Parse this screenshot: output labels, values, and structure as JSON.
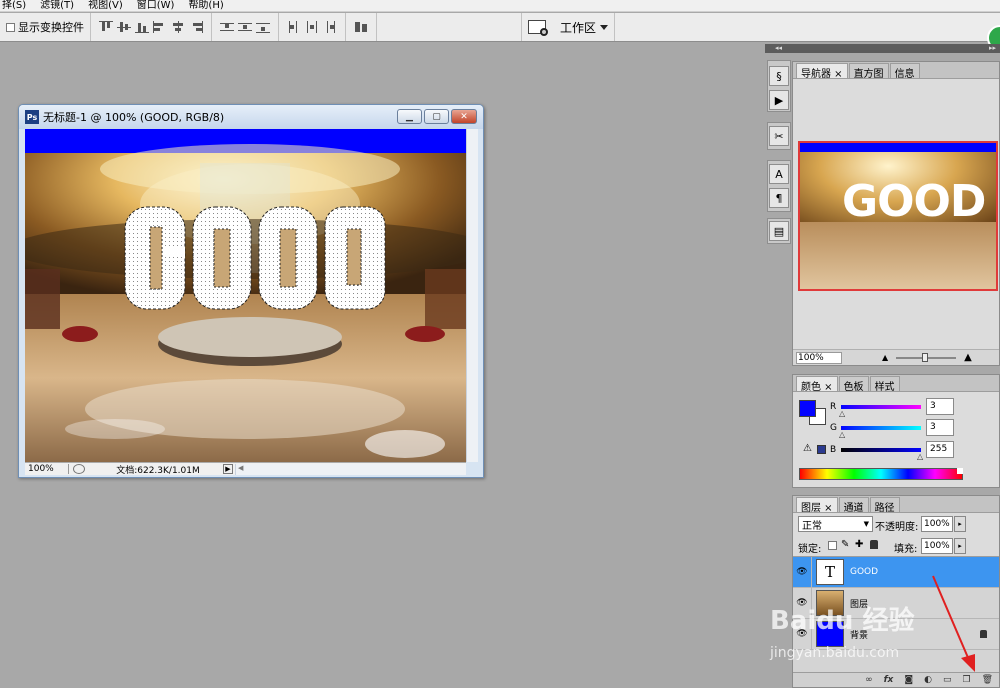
{
  "menubar": {
    "items": [
      "择(S)",
      "滤镜(T)",
      "视图(V)",
      "窗口(W)",
      "帮助(H)"
    ]
  },
  "options_bar": {
    "show_transform_controls": "显示变换控件",
    "workspace_label": "工作区"
  },
  "document": {
    "title": "无标题-1 @ 100% (GOOD, RGB/8)",
    "canvas_text": "GOOD",
    "zoom": "100%",
    "doc_info": "文档:622.3K/1.01M",
    "colors": {
      "blue_bar": "#0000ff"
    }
  },
  "navigator_panel": {
    "tabs": [
      "导航器",
      "直方图",
      "信息"
    ],
    "zoom": "100%",
    "preview_text": "GOOD"
  },
  "color_panel": {
    "tabs": [
      "颜色",
      "色板",
      "样式"
    ],
    "r_label": "R",
    "g_label": "G",
    "b_label": "B",
    "r_value": "3",
    "g_value": "3",
    "b_value": "255",
    "foreground": "#0303ff"
  },
  "layers_panel": {
    "tabs": [
      "图层",
      "通道",
      "路径"
    ],
    "blend_mode": "正常",
    "opacity_label": "不透明度:",
    "opacity": "100%",
    "lock_label": "锁定:",
    "fill_label": "填充:",
    "fill": "100%",
    "layers": [
      {
        "name": "GOOD",
        "type": "text",
        "selected": true
      },
      {
        "name": "图层",
        "type": "image",
        "selected": false
      },
      {
        "name": "背景",
        "type": "background",
        "selected": false
      }
    ],
    "type_glyph": "T"
  },
  "watermark": {
    "text": "Baidu 经验",
    "url_text": "jingyan.baidu.com"
  }
}
